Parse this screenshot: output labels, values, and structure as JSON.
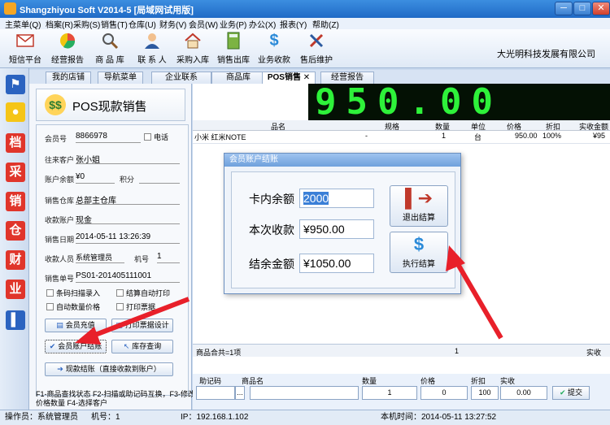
{
  "window": {
    "title": "Shangzhiyou Soft V2014-5 [局域网试用版]",
    "minimize": "─",
    "maximize": "□",
    "close": "✕"
  },
  "menu": [
    "主菜单(Q)",
    "档案(R)",
    "采购(S)",
    "销售(T)",
    "仓库(U)",
    "财务(V)",
    "会员(W)",
    "业务(P)",
    "办公(X)",
    "报表(Y)",
    "帮助(Z)"
  ],
  "toolbar": {
    "items": [
      {
        "label": "短信平台",
        "icon": "mail-icon"
      },
      {
        "label": "经营报告",
        "icon": "pie-chart-icon"
      },
      {
        "label": "商 品 库",
        "icon": "magnifier-icon"
      },
      {
        "label": "联 系 人",
        "icon": "contact-icon"
      },
      {
        "label": "采购入库",
        "icon": "house-icon"
      },
      {
        "label": "销售出库",
        "icon": "calculator-icon"
      },
      {
        "label": "业务收款",
        "icon": "dollar-icon"
      },
      {
        "label": "售后维护",
        "icon": "tools-icon"
      }
    ],
    "company": "大光明科技发展有限公司"
  },
  "sidebar": {
    "icons": [
      "flag-icon",
      "bulb-icon",
      "档",
      "采",
      "销",
      "仓",
      "财",
      "业",
      "exit-icon"
    ]
  },
  "tabs": [
    {
      "label": "我的店铺",
      "active": false
    },
    {
      "label": "导航菜单",
      "active": false
    },
    {
      "label": "企业联系",
      "active": false
    },
    {
      "label": "商品库",
      "active": false
    },
    {
      "label": "POS销售",
      "active": true,
      "close": "✕"
    },
    {
      "label": "经营报告",
      "active": false
    }
  ],
  "pos": {
    "header": "POS现款销售",
    "money_icon": "$$",
    "form": {
      "member_no_label": "会员号",
      "member_no": "8866978",
      "phone_label": "电话",
      "customer_label": "往来客户",
      "customer": "张小姐",
      "balance_label": "账户余额",
      "balance": "¥0",
      "points_label": "积分",
      "points": "",
      "warehouse_label": "销售仓库",
      "warehouse": "总部主仓库",
      "account_label": "收款账户",
      "account": "现金",
      "date_label": "销售日期",
      "date": "2014-05-11 13:26:39",
      "cashier_label": "收款人员",
      "cashier": "系统管理员",
      "machine_label": "机号",
      "machine": "1",
      "order_label": "销售单号",
      "order": "PS01-201405111001"
    },
    "checks": {
      "barcode": "条码扫描录入",
      "auto_print": "结算自动打印",
      "auto_qty": "自动数量价格",
      "print_bill": "打印票据"
    },
    "buttons": {
      "recharge": "会员充值",
      "print_design": "打印票据设计",
      "member_settle": "会员账户结账",
      "stock_query": "库存查询",
      "cash_settle": "现款结账（直接收款到账户）"
    },
    "hints": "F1-商品查找状态  F2-扫描或助记码互换，F3-修改价格数量  F4-选择客户"
  },
  "display": {
    "amount": "950.00"
  },
  "grid": {
    "headers": [
      "品名",
      "规格",
      "数量",
      "单位",
      "价格",
      "折扣",
      "实收金额"
    ],
    "rows": [
      [
        "小米 红米NOTE",
        "-",
        "1",
        "台",
        "950.00",
        "100%",
        "¥95"
      ]
    ],
    "summary_label": "商品合共=1项",
    "summary_qty": "1",
    "summary_amount_label": "实收"
  },
  "entry": {
    "labels": [
      "助记码",
      "商品名",
      "数量",
      "价格",
      "折扣",
      "实收"
    ],
    "values": {
      "code": "",
      "browse": "...",
      "qty": "1",
      "price": "0",
      "discount": "100",
      "actual": "0.00"
    },
    "submit": "提交"
  },
  "dialog": {
    "title": "会员账户结账",
    "card_balance_label": "卡内余额",
    "card_balance": "2000",
    "this_charge_label": "本次收款",
    "this_charge": "¥950.00",
    "remaining_label": "结余金额",
    "remaining": "¥1050.00",
    "exit_button": "退出结算",
    "execute_button": "执行结算"
  },
  "status": {
    "operator": "操作员：系统管理员",
    "machine": "机号：1",
    "ip": "IP：192.168.1.102",
    "time": "本机时间：2014-05-11 13:27:52"
  },
  "colors": {
    "led": "#2ef23a",
    "arrow": "#e8202a",
    "accent": "#2b63c0"
  }
}
